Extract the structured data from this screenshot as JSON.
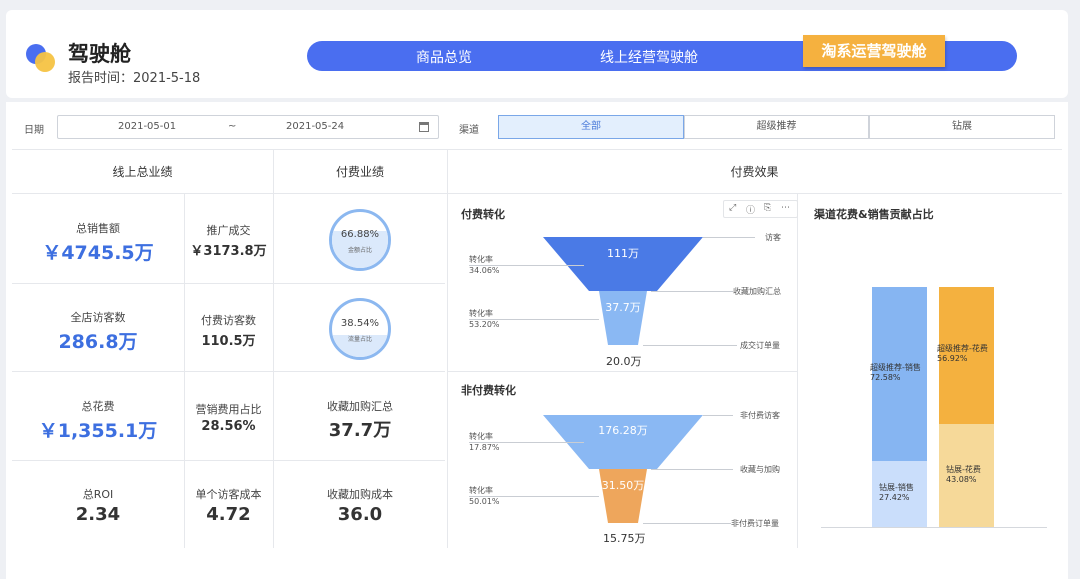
{
  "header": {
    "title": "驾驶舱",
    "report_time": "报告时间：2021-5-18",
    "logo_icon": "logo-icon"
  },
  "nav": {
    "items": [
      "商品总览",
      "线上经营驾驶舱"
    ],
    "active": "淘系运营驾驶舱"
  },
  "filters": {
    "date_label": "日期",
    "date_start": "2021-05-01",
    "date_sep": "~",
    "date_end": "2021-05-24",
    "channel_label": "渠道",
    "channels": [
      "全部",
      "超级推荐",
      "钻展"
    ],
    "active_channel": "全部"
  },
  "sections": {
    "online_total": "线上总业绩",
    "paid": "付费业绩",
    "effect": "付费效果"
  },
  "metrics": {
    "total_sales_label": "总销售额",
    "total_sales": "￥4745.5万",
    "promo_deal_label": "推广成交",
    "promo_deal": "￥3173.8万",
    "visitors_label": "全店访客数",
    "visitors": "286.8万",
    "paid_visitors_label": "付费访客数",
    "paid_visitors": "110.5万",
    "total_cost_label": "总花费",
    "total_cost": "￥1,355.1万",
    "mkt_ratio_label": "营销费用占比",
    "mkt_ratio": "28.56%",
    "fav_cart_label": "收藏加购汇总",
    "fav_cart": "37.7万",
    "roi_label": "总ROI",
    "roi": "2.34",
    "unit_cost_label": "单个访客成本",
    "unit_cost": "4.72",
    "fav_cost_label": "收藏加购成本",
    "fav_cost": "36.0"
  },
  "gauges": [
    {
      "pct": "66.88%",
      "value": 0.6688,
      "sub": "金额占比"
    },
    {
      "pct": "38.54%",
      "value": 0.3854,
      "sub": "流量占比"
    }
  ],
  "paid_funnel": {
    "title": "付费转化",
    "top": "111万",
    "middle": "37.7万",
    "bottom": "20.0万",
    "rate1_label": "转化率",
    "rate1": "34.06%",
    "rate2_label": "转化率",
    "rate2": "53.20%",
    "stage1": "访客",
    "stage2": "收藏加购汇总",
    "stage3": "成交订单量"
  },
  "free_funnel": {
    "title": "非付费转化",
    "top": "176.28万",
    "middle": "31.50万",
    "bottom": "15.75万",
    "rate1_label": "转化率",
    "rate1": "17.87%",
    "rate2_label": "转化率",
    "rate2": "50.01%",
    "stage1": "非付费访客",
    "stage2": "收藏与加购",
    "stage3": "非付费订单量"
  },
  "toolbar": {
    "icons": [
      "expand-icon",
      "info-icon",
      "export-icon",
      "more-icon"
    ]
  },
  "contribution": {
    "title": "渠道花费&销售贡献占比",
    "sales_bar": [
      {
        "label": "超级推荐-销售",
        "pct": "72.58%",
        "value": 0.7258
      },
      {
        "label": "钻展-销售",
        "pct": "27.42%",
        "value": 0.2742
      }
    ],
    "cost_bar": [
      {
        "label": "超级推荐-花费",
        "pct": "56.92%",
        "value": 0.5692
      },
      {
        "label": "钻展-花费",
        "pct": "43.08%",
        "value": 0.4308
      }
    ]
  },
  "colors": {
    "brand_blue": "#4a6ef0",
    "accent_orange": "#f5b13f",
    "metric_blue": "#3d6fe0"
  }
}
